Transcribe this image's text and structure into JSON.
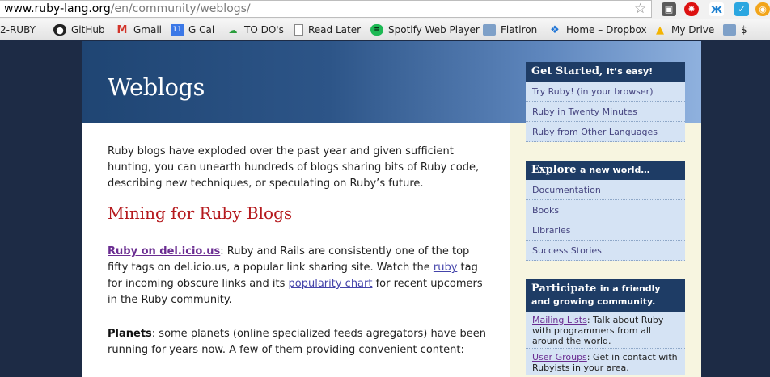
{
  "browser": {
    "url_host": "www.ruby-lang.org",
    "url_path": "/en/community/weblogs/",
    "bookmarks": [
      {
        "label": "2-RUBY",
        "icon": "page-icon"
      },
      {
        "label": "GitHub",
        "icon": "github-icon"
      },
      {
        "label": "Gmail",
        "icon": "gmail-icon"
      },
      {
        "label": "G Cal",
        "icon": "calendar-icon"
      },
      {
        "label": "TO DO's",
        "icon": "todo-icon"
      },
      {
        "label": "Read Later",
        "icon": "page-icon"
      },
      {
        "label": "Spotify Web Player",
        "icon": "spotify-icon"
      },
      {
        "label": "Flatiron",
        "icon": "folder-icon"
      },
      {
        "label": "Home – Dropbox",
        "icon": "dropbox-icon"
      },
      {
        "label": "My Drive",
        "icon": "drive-icon"
      },
      {
        "label": "$",
        "icon": "folder-icon"
      }
    ]
  },
  "page": {
    "title": "Weblogs",
    "intro": "Ruby blogs have exploded over the past year and given sufficient hunting, you can unearth hundreds of blogs sharing bits of Ruby code, describing new techniques, or speculating on Ruby’s future.",
    "section_heading": "Mining for Ruby Blogs",
    "delicious": {
      "link": "Ruby on del.icio.us",
      "text1": ": Ruby and Rails are consistently one of the top fifty tags on del.icio.us, a popular link sharing site. Watch the ",
      "ruby_link": "ruby",
      "text2": " tag for incoming obscure links and its ",
      "chart_link": "popularity chart",
      "text3": " for recent upcomers in the Ruby community."
    },
    "planets": {
      "label": "Planets",
      "text": ": some planets (online specialized feeds agregators) have been running for years now. A few of them providing convenient content:"
    }
  },
  "sidebar": {
    "get_started": {
      "title": "Get Started,",
      "subtitle": "it’s easy!",
      "items": [
        "Try Ruby! (in your browser)",
        "Ruby in Twenty Minutes",
        "Ruby from Other Languages"
      ]
    },
    "explore": {
      "title": "Explore",
      "subtitle": "a new world…",
      "items": [
        "Documentation",
        "Books",
        "Libraries",
        "Success Stories"
      ]
    },
    "participate": {
      "title": "Participate",
      "subtitle": "in a friendly and growing community.",
      "mailing_link": "Mailing Lists",
      "mailing_text": ": Talk about Ruby with programmers from all around the world.",
      "groups_link": "User Groups",
      "groups_text": ": Get in contact with Rubyists in your area."
    }
  }
}
